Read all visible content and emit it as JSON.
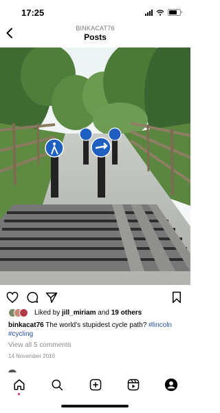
{
  "status_bar": {
    "time": "17:25"
  },
  "header": {
    "username": "BINKACAT76",
    "title": "Posts"
  },
  "post": {
    "photo_alt": "Cycle path with cattle grid and blue cycle signs on bollards",
    "likes": {
      "prefix": "Liked by ",
      "user": "jill_miriam",
      "middle": " and ",
      "others": "19 others"
    },
    "caption": {
      "author": "binkacat76",
      "text": " The world's stupidest cycle path? ",
      "hashtags": [
        "#lincoln",
        "#cycling"
      ]
    },
    "comments_link": "View all 5 comments",
    "date": "14 November 2016"
  },
  "colors": {
    "hashtag": "#2a4fa0",
    "muted": "#8e8e8e",
    "notification_dot": "#e0245e",
    "sign_blue": "#1f5fbf"
  },
  "icons": {
    "actions": [
      "heart-icon",
      "comment-icon",
      "share-icon",
      "bookmark-icon"
    ],
    "tabs": [
      "home-icon",
      "search-icon",
      "create-icon",
      "reels-icon",
      "profile-icon"
    ]
  }
}
